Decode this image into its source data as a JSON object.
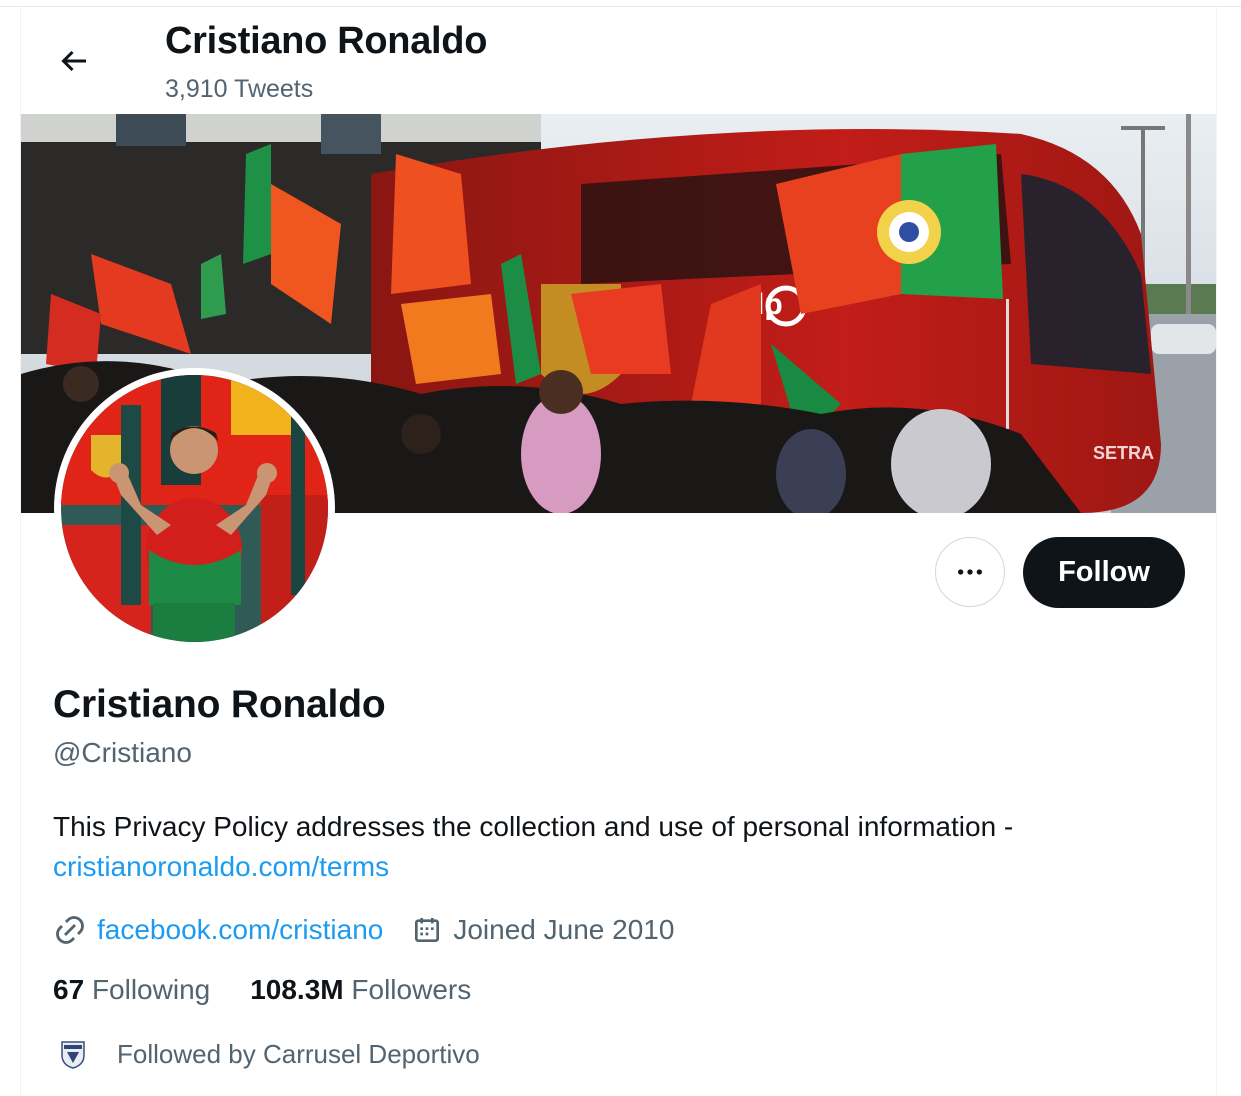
{
  "header": {
    "title": "Cristiano Ronaldo",
    "tweet_count": "3,910 Tweets"
  },
  "profile": {
    "display_name": "Cristiano Ronaldo",
    "handle": "@Cristiano",
    "bio_text": "This Privacy Policy addresses the collection and use of personal information -",
    "bio_link": "cristianoronaldo.com/terms",
    "website": "facebook.com/cristiano",
    "joined": "Joined June 2010",
    "following_count": "67",
    "following_label": "Following",
    "followers_count": "108.3M",
    "followers_label": "Followers",
    "followed_by": "Followed by Carrusel Deportivo"
  },
  "actions": {
    "follow_label": "Follow",
    "more_label": "•••"
  },
  "banner": {
    "bus_brand": "galp",
    "bus_model": "SETRA"
  },
  "colors": {
    "link": "#1d9bf0",
    "text": "#0f1419",
    "secondary": "#536471",
    "follow_bg": "#0f1419"
  }
}
